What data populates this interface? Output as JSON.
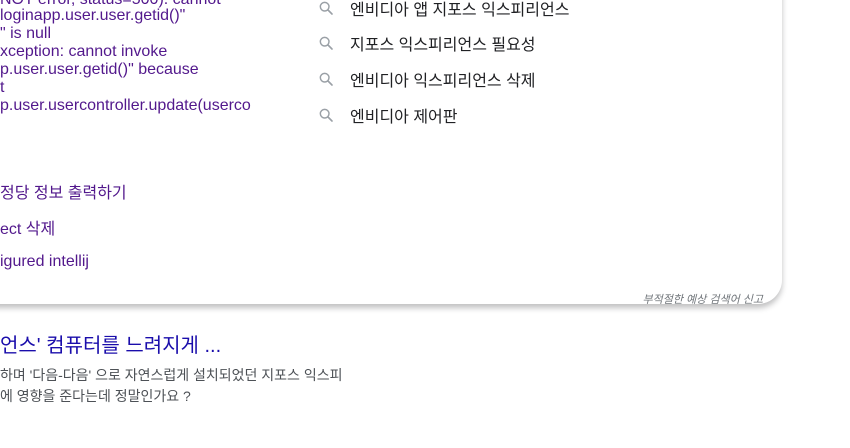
{
  "history": [
    "NOT error, status=500). cannot",
    "loginapp.user.user.getid()\"",
    "\" is null",
    "xception: cannot invoke",
    "p.user.user.getid()\" because",
    "t",
    "p.user.usercontroller.update(userco",
    "정당 정보 출력하기",
    "ect 삭제",
    "igured intellij"
  ],
  "suggestions": [
    {
      "label": "엔비디아 앱 지포스 익스피리언스",
      "icon": "search-icon"
    },
    {
      "label": "지포스 익스피리언스 필요성",
      "icon": "search-icon"
    },
    {
      "label": "엔비디아 익스피리언스 삭제",
      "icon": "search-icon"
    },
    {
      "label": "엔비디아 제어판",
      "icon": "search-icon"
    }
  ],
  "report_link": "부적절한 예상 검색어 신고",
  "result": {
    "title": "언스' 컴퓨터를 느려지게 ...",
    "snippet_line1": "하며 '다음-다음' 으로 자연스럽게 설치되었던 지포스 익스피",
    "snippet_line2": "에 영향을 준다는데 정말인가요 ?"
  },
  "colors": {
    "visited_link": "#52188c",
    "title_link": "#1a0dab",
    "suggestion_text": "#202124",
    "icon": "#9aa0a6"
  }
}
